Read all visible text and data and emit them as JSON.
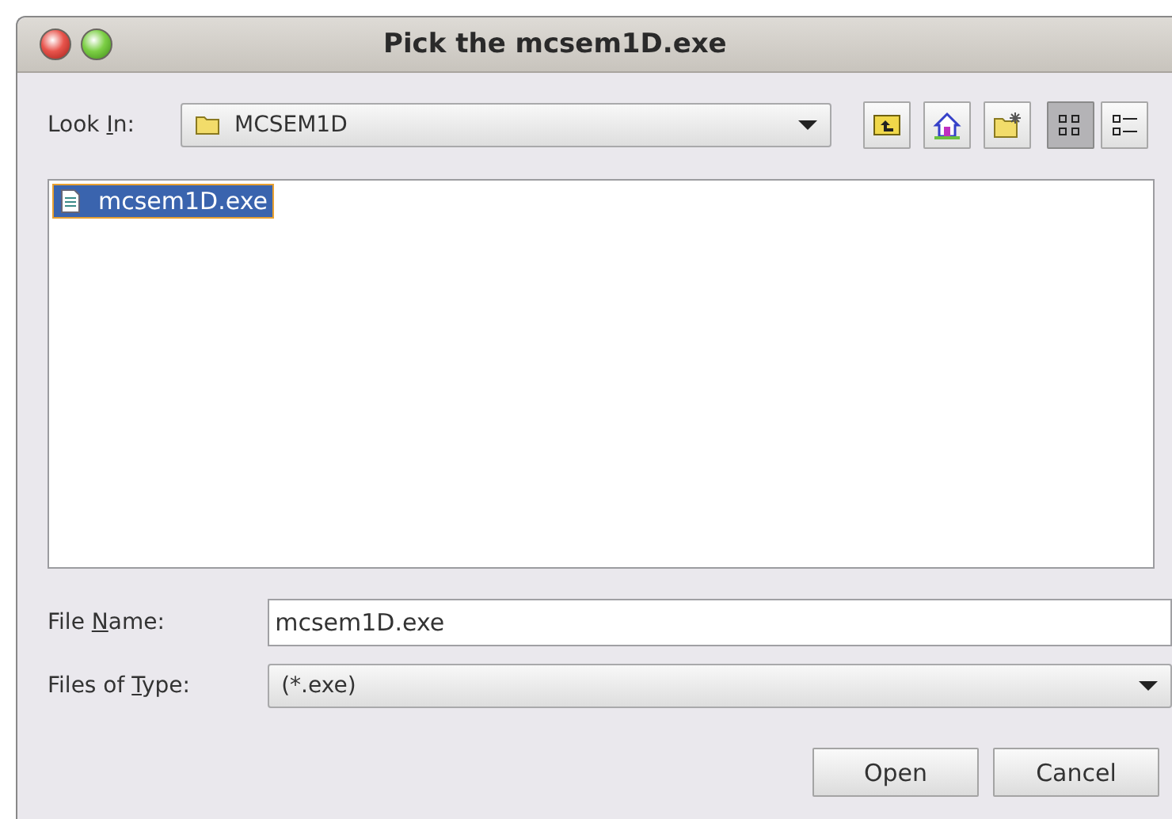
{
  "window": {
    "title": "Pick the mcsem1D.exe",
    "buttons": [
      {
        "kind": "close"
      },
      {
        "kind": "maximize"
      }
    ]
  },
  "look_in": {
    "label": {
      "before": "Look ",
      "key": "I",
      "after": "n:"
    },
    "value": "MCSEM1D"
  },
  "toolbar": [
    {
      "kind": "up-folder"
    },
    {
      "kind": "home"
    },
    {
      "kind": "new-folder"
    }
  ],
  "views": [
    {
      "kind": "list",
      "selected": true
    },
    {
      "kind": "details",
      "selected": false
    }
  ],
  "files": [
    {
      "name": "mcsem1D.exe",
      "selected": true
    }
  ],
  "file_name": {
    "label": {
      "before": "File ",
      "key": "N",
      "after": "ame:"
    },
    "value": "mcsem1D.exe"
  },
  "file_type": {
    "label": {
      "before": "Files of ",
      "key": "T",
      "after": "ype:"
    },
    "value": "(*.exe)"
  },
  "buttons": [
    "Open",
    "Cancel"
  ]
}
